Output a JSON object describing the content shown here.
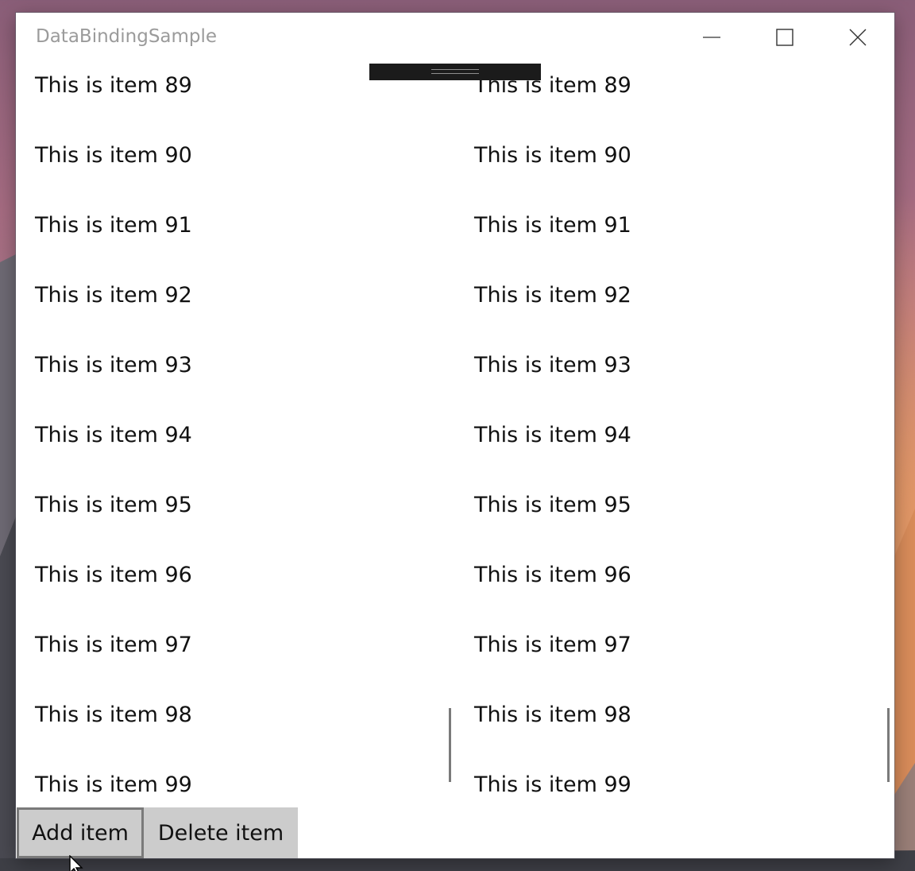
{
  "window": {
    "title": "DataBindingSample"
  },
  "caption_buttons": {
    "minimize_icon": "minimize-icon",
    "maximize_icon": "maximize-icon",
    "close_icon": "close-icon"
  },
  "left_list": {
    "items": [
      "This is item 89",
      "This is item 90",
      "This is item 91",
      "This is item 92",
      "This is item 93",
      "This is item 94",
      "This is item 95",
      "This is item 96",
      "This is item 97",
      "This is item 98",
      "This is item 99"
    ]
  },
  "right_list": {
    "items": [
      "This is item 89",
      "This is item 90",
      "This is item 91",
      "This is item 92",
      "This is item 93",
      "This is item 94",
      "This is item 95",
      "This is item 96",
      "This is item 97",
      "This is item 98",
      "This is item 99"
    ]
  },
  "buttons": {
    "add_label": "Add item",
    "delete_label": "Delete item"
  },
  "colors": {
    "window_bg": "#ffffff",
    "title_text": "#9b9b9b",
    "item_text": "#111111",
    "button_bg": "#cccccc",
    "button_border_focus": "#7a7a7a",
    "drag_handle": "#1b1b1b",
    "scrollbar": "#7a7a7a"
  }
}
